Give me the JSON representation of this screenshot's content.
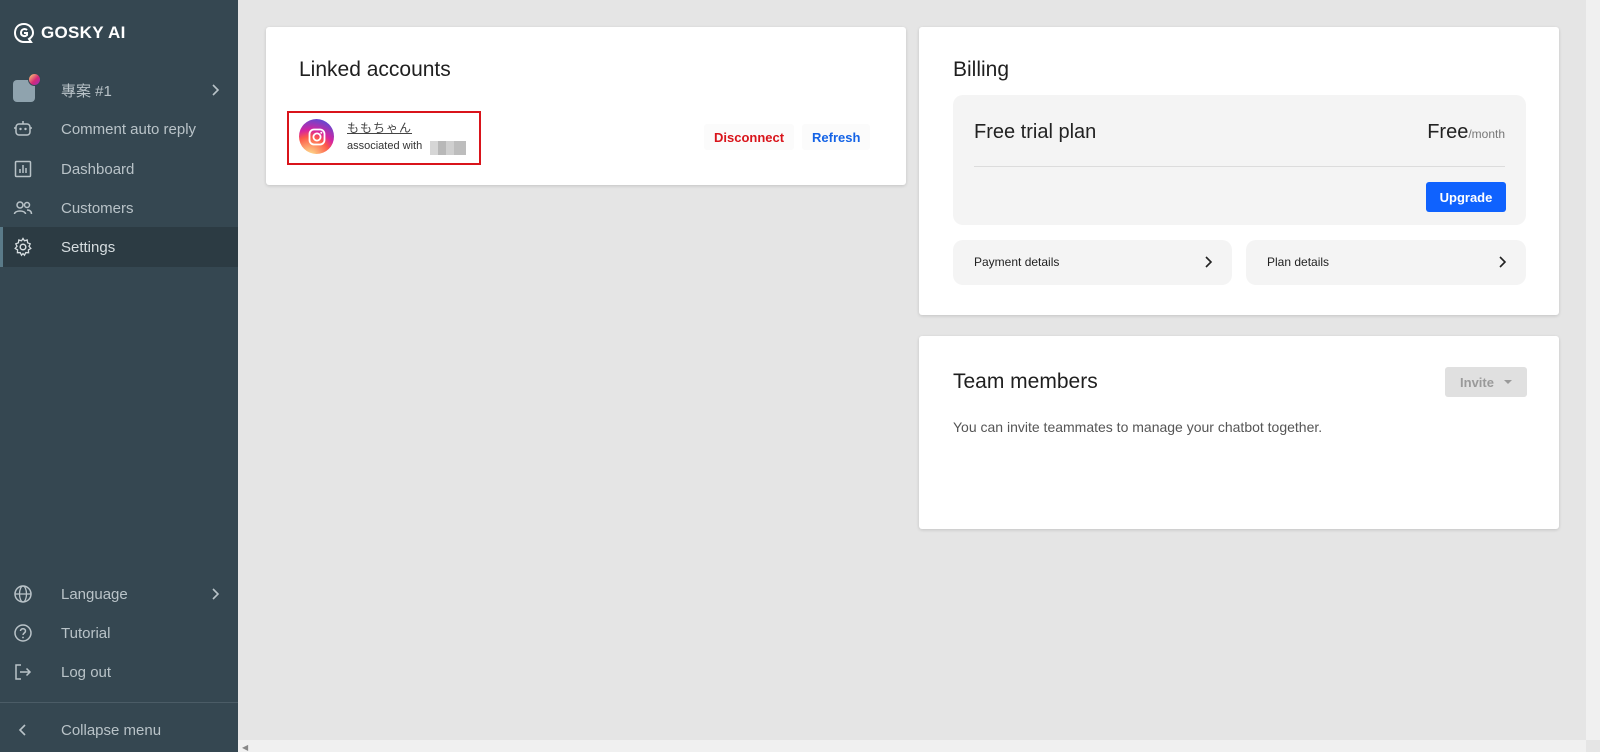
{
  "sidebar": {
    "brand": "GOSKY AI",
    "project": "專案 #1",
    "items": [
      {
        "label": "Comment auto reply",
        "icon": "robot-icon"
      },
      {
        "label": "Dashboard",
        "icon": "chart-icon"
      },
      {
        "label": "Customers",
        "icon": "users-icon"
      },
      {
        "label": "Settings",
        "icon": "gear-icon"
      }
    ],
    "bottom_items": [
      {
        "label": "Language",
        "icon": "globe-icon"
      },
      {
        "label": "Tutorial",
        "icon": "help-icon"
      },
      {
        "label": "Log out",
        "icon": "logout-icon"
      }
    ],
    "collapse_label": "Collapse menu"
  },
  "linked_accounts": {
    "title": "Linked accounts",
    "account_name": "ももちゃん",
    "associated_with": "associated with",
    "disconnect_label": "Disconnect",
    "refresh_label": "Refresh"
  },
  "billing": {
    "title": "Billing",
    "plan_name": "Free trial plan",
    "price": "Free",
    "price_unit": "/month",
    "upgrade_label": "Upgrade",
    "payment_details_label": "Payment details",
    "plan_details_label": "Plan details"
  },
  "team": {
    "title": "Team members",
    "invite_label": "Invite",
    "description": "You can invite teammates to manage your chatbot together."
  },
  "colors": {
    "sidebar_bg": "#354751",
    "primary": "#0f62fe",
    "danger": "#d9141b",
    "link": "#1463e6"
  }
}
